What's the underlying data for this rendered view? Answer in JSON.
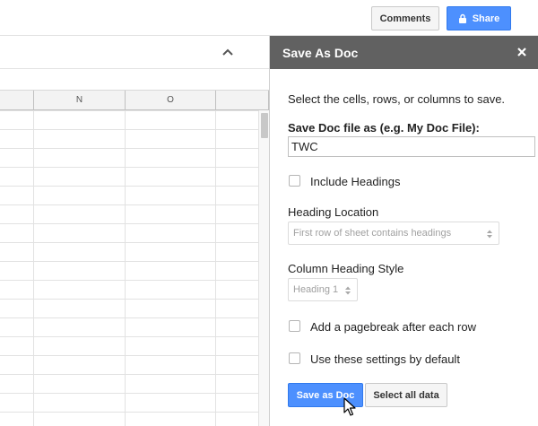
{
  "topbar": {
    "comments_label": "Comments",
    "share_label": "Share",
    "share_color": "#4d90fe"
  },
  "sheet": {
    "columns": [
      "N",
      "O"
    ],
    "collapse_icon": "chevron-up-icon"
  },
  "panel": {
    "title": "Save As Doc",
    "close_icon": "close-icon",
    "intro": "Select the cells, rows, or columns to save.",
    "filename_label": "Save Doc file as (e.g. My Doc File):",
    "filename_value": "TWC",
    "include_headings_label": "Include Headings",
    "include_headings_checked": false,
    "heading_location_label": "Heading Location",
    "heading_location_value": "First row of sheet contains headings",
    "column_heading_style_label": "Column Heading Style",
    "column_heading_style_value": "Heading 1",
    "pagebreak_label": "Add a pagebreak after each row",
    "pagebreak_checked": false,
    "default_label": "Use these settings by default",
    "default_checked": false,
    "save_button_label": "Save as Doc",
    "select_all_label": "Select all data",
    "header_color": "#616161"
  }
}
